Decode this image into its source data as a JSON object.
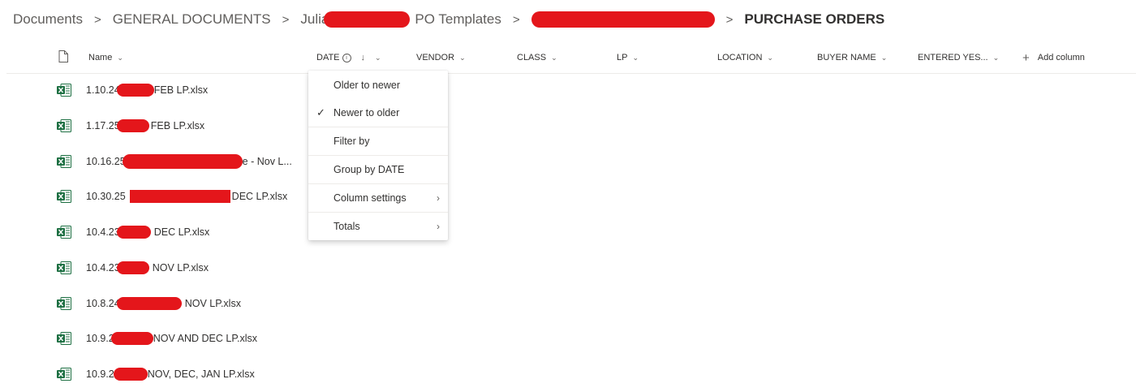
{
  "breadcrumb": {
    "items": [
      "Documents",
      "GENERAL DOCUMENTS",
      "Julia",
      "PO Templates",
      "PURCHASE ORDERS"
    ],
    "separator": ">"
  },
  "columns": {
    "name": "Name",
    "date": "DATE",
    "vendor": "VENDOR",
    "class": "CLASS",
    "lp": "LP",
    "location": "LOCATION",
    "buyer_name": "BUYER NAME",
    "entered": "ENTERED YES...",
    "add_column": "Add column"
  },
  "files": [
    {
      "prefix": "1.10.24",
      "suffix": "FEB LP.xlsx"
    },
    {
      "prefix": "1.17.25",
      "suffix": "FEB LP.xlsx"
    },
    {
      "prefix": "10.16.25",
      "suffix": "e - Nov L..."
    },
    {
      "prefix": "10.30.25",
      "suffix": "DEC LP.xlsx"
    },
    {
      "prefix": "10.4.23",
      "suffix": "DEC LP.xlsx"
    },
    {
      "prefix": "10.4.23",
      "suffix": "NOV LP.xlsx"
    },
    {
      "prefix": "10.8.24",
      "suffix": "NOV LP.xlsx"
    },
    {
      "prefix": "10.9.2",
      "suffix": "NOV AND DEC LP.xlsx"
    },
    {
      "prefix": "10.9.24",
      "suffix": "NOV, DEC, JAN LP.xlsx"
    }
  ],
  "menu": {
    "items": [
      "Older to newer",
      "Newer to older",
      "Filter by",
      "Group by DATE",
      "Column settings",
      "Totals"
    ],
    "selected": "Newer to older"
  },
  "icons": {
    "excel": "excel-file-icon",
    "file_header": "file-type-icon",
    "info": "info-icon",
    "sort": "sort-descending-icon",
    "check": "checkmark-icon",
    "submenu": "chevron-right-icon",
    "add": "plus-icon"
  },
  "colors": {
    "excel_green": "#1d6f42",
    "redaction": "#e4161b",
    "text": "#323130",
    "muted": "#605e5c"
  }
}
